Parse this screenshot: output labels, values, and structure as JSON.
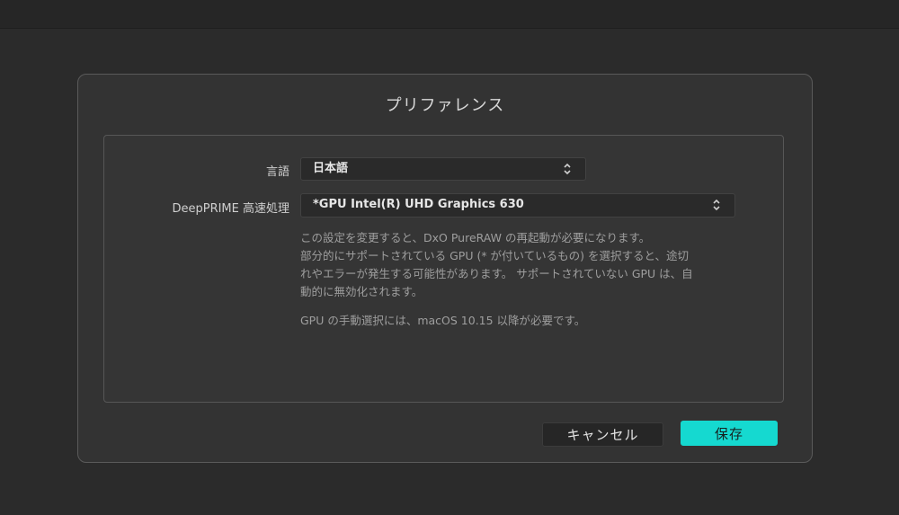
{
  "dialog": {
    "title": "プリファレンス",
    "language": {
      "label": "言語",
      "value": "日本語"
    },
    "deepprime": {
      "label": "DeepPRIME 高速処理",
      "value": "*GPU Intel(R) UHD Graphics 630"
    },
    "info": {
      "line1": "この設定を変更すると、DxO PureRAW の再起動が必要になります。",
      "line2": "部分的にサポートされている GPU (* が付いているもの) を選択すると、途切",
      "line3": "れやエラーが発生する可能性があります。 サポートされていない GPU は、自",
      "line4": "動的に無効化されます。",
      "note": "GPU の手動選択には、macOS 10.15 以降が必要です。"
    },
    "buttons": {
      "cancel": "キャンセル",
      "save": "保存"
    }
  },
  "colors": {
    "accent": "#15d9d0",
    "background": "#2b2b2b",
    "dialog": "#333333"
  },
  "icons": {
    "select_arrows": "updown-chevron-icon"
  }
}
